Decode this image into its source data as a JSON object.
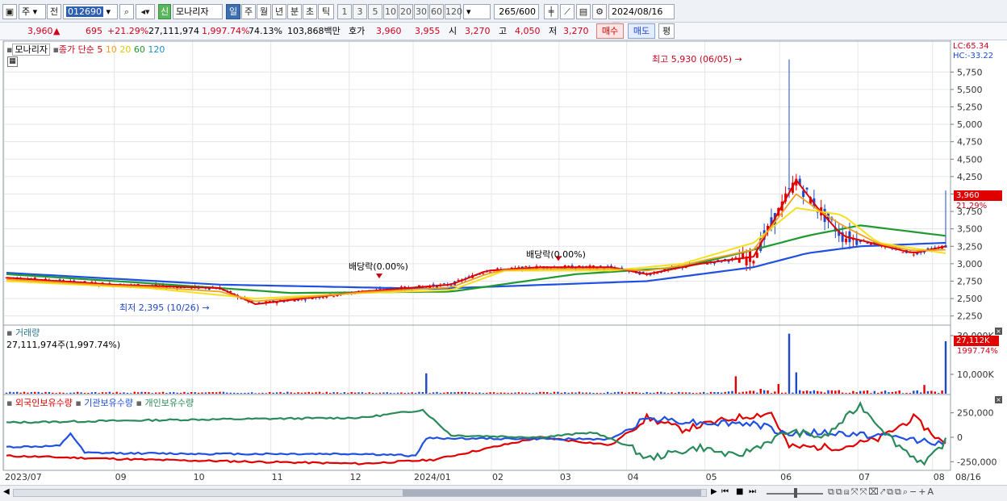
{
  "toolbar": {
    "market": "주",
    "prev_label": "전",
    "code": "012690",
    "new_badge": "신",
    "stock_name": "모나리자",
    "periods": [
      "일",
      "주",
      "월",
      "년",
      "분",
      "초",
      "틱"
    ],
    "active_period": "일",
    "intervals": [
      "1",
      "3",
      "5",
      "10",
      "20",
      "30",
      "60",
      "120"
    ],
    "count": "265",
    "count_total": "/600",
    "date": "2024/08/16"
  },
  "quote": {
    "price": "3,960",
    "up_arrow": "▲",
    "change": "695",
    "change_pct": "+21.29%",
    "volume": "27,111,974",
    "volume_pct": "1,997.74%",
    "ratio": "74.13%",
    "amount": "103,868백만",
    "hoga_label": "호가",
    "hoga_ask": "3,960",
    "hoga_bid": "3,955",
    "open_label": "시",
    "open": "3,270",
    "high_label": "고",
    "high": "4,050",
    "low_label": "저",
    "low": "3,270",
    "buy_button": "매수",
    "sell_button": "매도",
    "eval_button": "평"
  },
  "legend": {
    "name": "모나리자",
    "ma_label": "종가 단순",
    "ma5": "5",
    "ma10": "10",
    "ma20": "20",
    "ma60": "60",
    "ma120": "120"
  },
  "annotations": {
    "high": "최고 5,930 (06/05)",
    "low": "최저 2,395 (10/26)",
    "div1": "배당락(0.00%)",
    "div2": "배당락(0.00%)",
    "lc": "LC:65.34",
    "hc": "HC:-33.22",
    "price_tag": "3,960",
    "pct_tag": "21.29%"
  },
  "volume_panel": {
    "title": "거래량",
    "info": "27,111,974주(1,997.74%)",
    "tag": "27,112K",
    "tag_pct": "1997.74%"
  },
  "holdings_panel": {
    "foreign": "외국인보유수량",
    "institution": "기관보유수량",
    "individual": "개인보유수량"
  },
  "colors": {
    "ma5": "#e00000",
    "ma10": "#f0a020",
    "ma20": "#f5e020",
    "ma60": "#1f9a30",
    "ma120": "#2050e0",
    "up": "#e00000",
    "down": "#1e48c8"
  },
  "chart_data": [
    {
      "type": "candlestick",
      "y_ticks": [
        "5,750",
        "5,500",
        "5,250",
        "5,000",
        "4,750",
        "4,500",
        "4,250",
        "4,000",
        "3,750",
        "3,500",
        "3,250",
        "3,000",
        "2,750",
        "2,500",
        "2,250"
      ],
      "x_labels": [
        "2023/07",
        "09",
        "10",
        "11",
        "12",
        "2024/01",
        "02",
        "03",
        "04",
        "05",
        "06",
        "07",
        "08",
        "08/16"
      ],
      "ylim": [
        2200,
        5950
      ],
      "ma_keypoints": {
        "ma5": [
          [
            0,
            2800
          ],
          [
            30,
            2700
          ],
          [
            60,
            2650
          ],
          [
            70,
            2420
          ],
          [
            100,
            2600
          ],
          [
            125,
            2700
          ],
          [
            135,
            2900
          ],
          [
            150,
            2950
          ],
          [
            170,
            2950
          ],
          [
            180,
            2850
          ],
          [
            195,
            3000
          ],
          [
            210,
            3100
          ],
          [
            222,
            4200
          ],
          [
            228,
            3800
          ],
          [
            235,
            3400
          ],
          [
            255,
            3150
          ],
          [
            264,
            3250
          ]
        ],
        "ma20": [
          [
            0,
            2750
          ],
          [
            40,
            2650
          ],
          [
            70,
            2500
          ],
          [
            100,
            2580
          ],
          [
            125,
            2620
          ],
          [
            140,
            2900
          ],
          [
            170,
            2900
          ],
          [
            190,
            3000
          ],
          [
            210,
            3300
          ],
          [
            222,
            3800
          ],
          [
            235,
            3700
          ],
          [
            245,
            3300
          ],
          [
            264,
            3150
          ]
        ],
        "ma60": [
          [
            0,
            2850
          ],
          [
            40,
            2720
          ],
          [
            80,
            2580
          ],
          [
            125,
            2600
          ],
          [
            160,
            2850
          ],
          [
            190,
            2950
          ],
          [
            210,
            3200
          ],
          [
            225,
            3400
          ],
          [
            240,
            3550
          ],
          [
            264,
            3400
          ]
        ],
        "ma120": [
          [
            0,
            2870
          ],
          [
            60,
            2700
          ],
          [
            120,
            2640
          ],
          [
            180,
            2750
          ],
          [
            210,
            2950
          ],
          [
            225,
            3150
          ],
          [
            240,
            3250
          ],
          [
            264,
            3300
          ]
        ]
      }
    },
    {
      "type": "bar",
      "name": "거래량",
      "y_ticks": [
        "30,000K",
        "10,000K"
      ],
      "ylim": [
        0,
        30000
      ]
    },
    {
      "type": "line",
      "name": "보유수량",
      "series": [
        {
          "name": "외국인보유수량"
        },
        {
          "name": "기관보유수량"
        },
        {
          "name": "개인보유수량"
        }
      ],
      "y_ticks": [
        "250,000",
        "0",
        "-250,000"
      ],
      "ylim": [
        -330000,
        330000
      ]
    }
  ]
}
